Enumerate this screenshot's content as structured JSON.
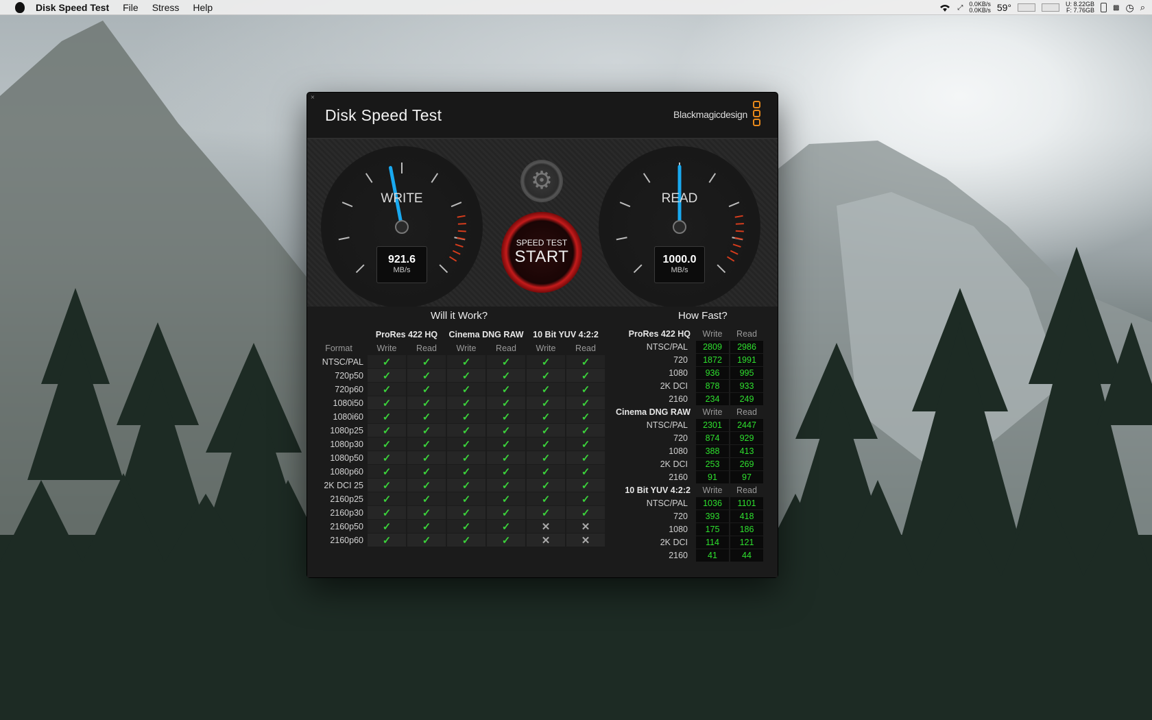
{
  "menubar": {
    "app_name": "Disk Speed Test",
    "menus": [
      "File",
      "Stress",
      "Help"
    ],
    "net_up": "0.0KB/s",
    "net_down": "0.0KB/s",
    "temperature": "59°",
    "disk_used": "U: 8.22GB",
    "disk_free": "F: 7.76GB"
  },
  "window": {
    "close_glyph": "×",
    "title": "Disk Speed Test",
    "brand": "Blackmagicdesign",
    "brand_color": "#e8891b"
  },
  "gauges": {
    "write": {
      "label": "WRITE",
      "value": "921.6",
      "unit": "MB/s",
      "needle_level": 0.46
    },
    "read": {
      "label": "READ",
      "value": "1000.0",
      "unit": "MB/s",
      "needle_level": 0.5
    },
    "settings_icon": "gear-icon",
    "start_top": "SPEED TEST",
    "start_main": "START"
  },
  "will_it_work": {
    "title": "Will it Work?",
    "codecs": [
      "ProRes 422 HQ",
      "Cinema DNG RAW",
      "10 Bit YUV 4:2:2"
    ],
    "format_label": "Format",
    "write_label": "Write",
    "read_label": "Read",
    "rows": [
      {
        "format": "NTSC/PAL",
        "results": [
          true,
          true,
          true,
          true,
          true,
          true
        ]
      },
      {
        "format": "720p50",
        "results": [
          true,
          true,
          true,
          true,
          true,
          true
        ]
      },
      {
        "format": "720p60",
        "results": [
          true,
          true,
          true,
          true,
          true,
          true
        ]
      },
      {
        "format": "1080i50",
        "results": [
          true,
          true,
          true,
          true,
          true,
          true
        ]
      },
      {
        "format": "1080i60",
        "results": [
          true,
          true,
          true,
          true,
          true,
          true
        ]
      },
      {
        "format": "1080p25",
        "results": [
          true,
          true,
          true,
          true,
          true,
          true
        ]
      },
      {
        "format": "1080p30",
        "results": [
          true,
          true,
          true,
          true,
          true,
          true
        ]
      },
      {
        "format": "1080p50",
        "results": [
          true,
          true,
          true,
          true,
          true,
          true
        ]
      },
      {
        "format": "1080p60",
        "results": [
          true,
          true,
          true,
          true,
          true,
          true
        ]
      },
      {
        "format": "2K DCI 25",
        "results": [
          true,
          true,
          true,
          true,
          true,
          true
        ]
      },
      {
        "format": "2160p25",
        "results": [
          true,
          true,
          true,
          true,
          true,
          true
        ]
      },
      {
        "format": "2160p30",
        "results": [
          true,
          true,
          true,
          true,
          true,
          true
        ]
      },
      {
        "format": "2160p50",
        "results": [
          true,
          true,
          true,
          true,
          false,
          false
        ]
      },
      {
        "format": "2160p60",
        "results": [
          true,
          true,
          true,
          true,
          false,
          false
        ]
      }
    ],
    "check_glyph": "✓",
    "cross_glyph": "✕"
  },
  "how_fast": {
    "title": "How Fast?",
    "write_label": "Write",
    "read_label": "Read",
    "groups": [
      {
        "name": "ProRes 422 HQ",
        "rows": [
          {
            "label": "NTSC/PAL",
            "write": "2809",
            "read": "2986"
          },
          {
            "label": "720",
            "write": "1872",
            "read": "1991"
          },
          {
            "label": "1080",
            "write": "936",
            "read": "995"
          },
          {
            "label": "2K DCI",
            "write": "878",
            "read": "933"
          },
          {
            "label": "2160",
            "write": "234",
            "read": "249"
          }
        ]
      },
      {
        "name": "Cinema DNG RAW",
        "rows": [
          {
            "label": "NTSC/PAL",
            "write": "2301",
            "read": "2447"
          },
          {
            "label": "720",
            "write": "874",
            "read": "929"
          },
          {
            "label": "1080",
            "write": "388",
            "read": "413"
          },
          {
            "label": "2K DCI",
            "write": "253",
            "read": "269"
          },
          {
            "label": "2160",
            "write": "91",
            "read": "97"
          }
        ]
      },
      {
        "name": "10 Bit YUV 4:2:2",
        "rows": [
          {
            "label": "NTSC/PAL",
            "write": "1036",
            "read": "1101"
          },
          {
            "label": "720",
            "write": "393",
            "read": "418"
          },
          {
            "label": "1080",
            "write": "175",
            "read": "186"
          },
          {
            "label": "2K DCI",
            "write": "114",
            "read": "121"
          },
          {
            "label": "2160",
            "write": "41",
            "read": "44"
          }
        ]
      }
    ]
  }
}
